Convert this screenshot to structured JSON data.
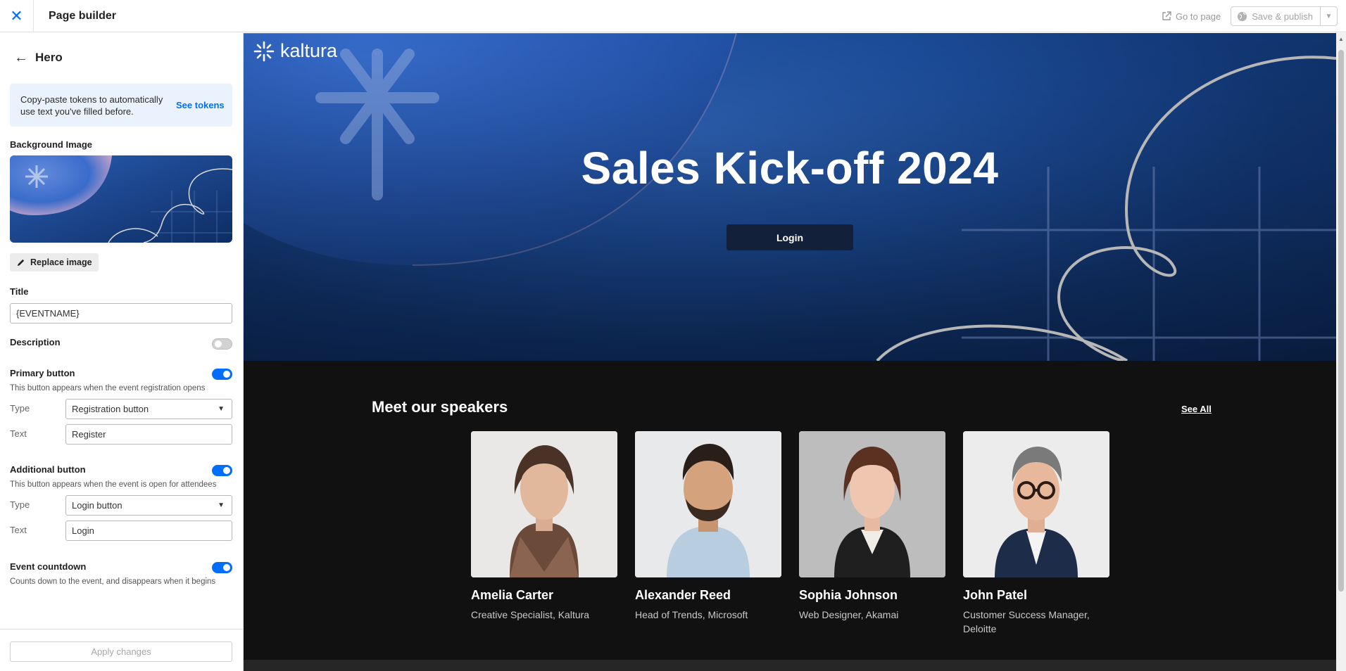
{
  "topbar": {
    "title": "Page builder",
    "go_to_page": "Go to page",
    "save_publish": "Save & publish"
  },
  "panel": {
    "title": "Hero",
    "tokens_text": "Copy-paste tokens to automatically use text you've filled before.",
    "tokens_link": "See tokens",
    "background_label": "Background Image",
    "replace_label": "Replace image",
    "title_label": "Title",
    "title_value": "{EVENTNAME}",
    "description_label": "Description",
    "description_on": false,
    "primary": {
      "label": "Primary button",
      "enabled": true,
      "hint": "This button appears when the event registration opens",
      "type_label": "Type",
      "type_value": "Registration button",
      "text_label": "Text",
      "text_value": "Register"
    },
    "additional": {
      "label": "Additional button",
      "enabled": true,
      "hint": "This button appears when the event is open for attendees",
      "type_label": "Type",
      "type_value": "Login button",
      "text_label": "Text",
      "text_value": "Login"
    },
    "countdown": {
      "label": "Event countdown",
      "enabled": true,
      "hint": "Counts down to the event, and disappears when it begins"
    },
    "apply_label": "Apply changes"
  },
  "preview": {
    "logo_text": "kaltura",
    "hero_title": "Sales Kick-off 2024",
    "hero_button": "Login",
    "speakers_title": "Meet our speakers",
    "see_all": "See All",
    "speakers": [
      {
        "name": "Amelia Carter",
        "role": "Creative Specialist, Kaltura"
      },
      {
        "name": "Alexander Reed",
        "role": "Head of Trends, Microsoft"
      },
      {
        "name": "Sophia Johnson",
        "role": "Web Designer, Akamai"
      },
      {
        "name": "John Patel",
        "role": "Customer Success Manager, Deloitte"
      }
    ]
  },
  "colors": {
    "accent": "#006efa",
    "hero_blue": "#1c4c99",
    "preview_bg": "#111111"
  }
}
